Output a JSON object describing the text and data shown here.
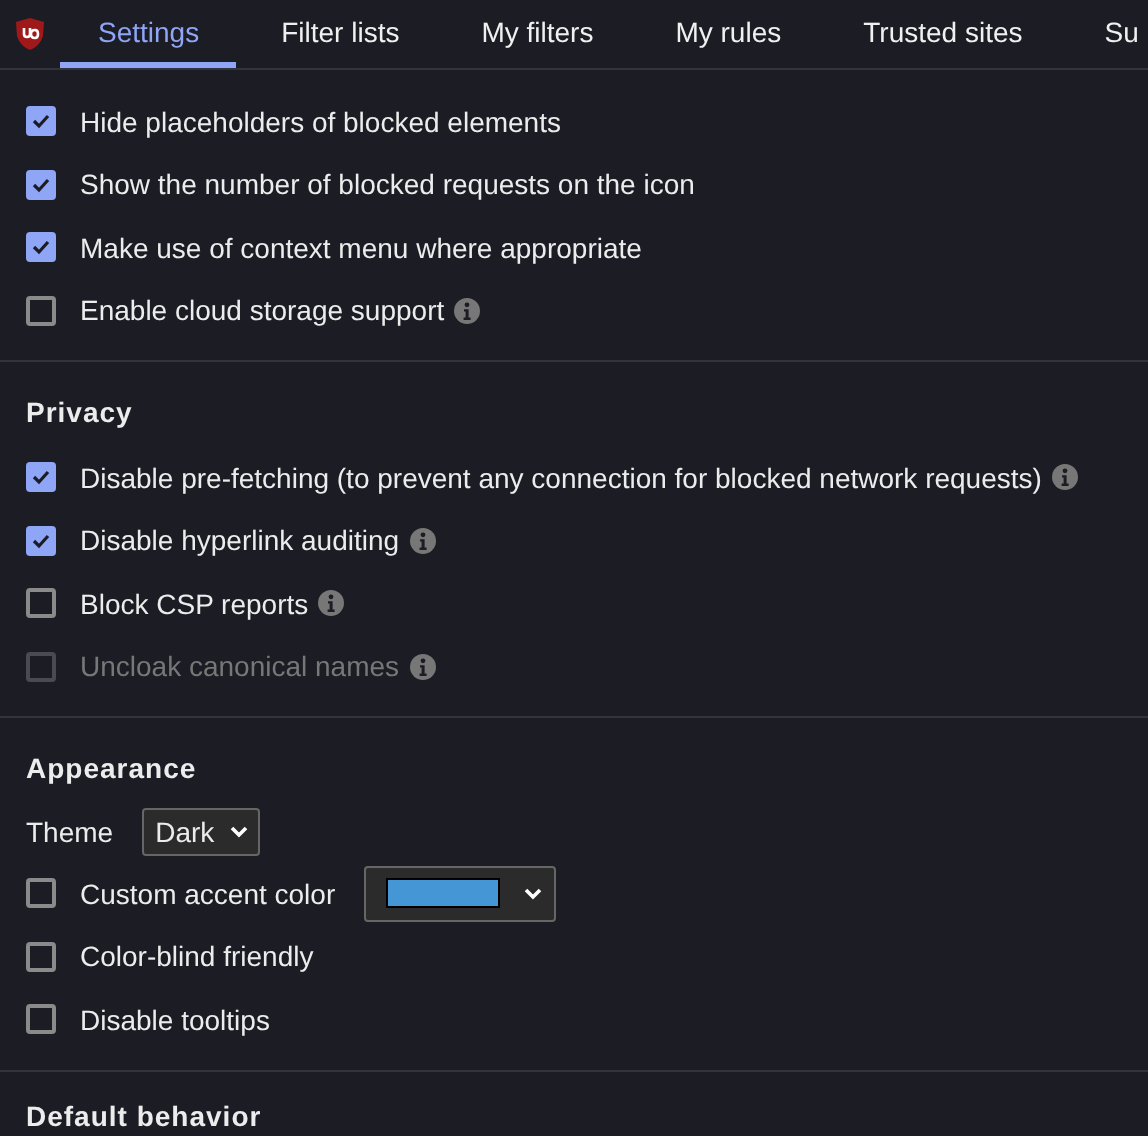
{
  "tabs": [
    {
      "label": "Settings",
      "selected": true
    },
    {
      "label": "Filter lists",
      "selected": false
    },
    {
      "label": "My filters",
      "selected": false
    },
    {
      "label": "My rules",
      "selected": false
    },
    {
      "label": "Trusted sites",
      "selected": false
    },
    {
      "label": "Su",
      "selected": false
    }
  ],
  "sections": [
    {
      "items": [
        {
          "kind": "checkbox",
          "label": "Hide placeholders of blocked elements",
          "checked": true,
          "disabled": false,
          "info": false
        },
        {
          "kind": "checkbox",
          "label": "Show the number of blocked requests on the icon",
          "checked": true,
          "disabled": false,
          "info": false
        },
        {
          "kind": "checkbox",
          "label": "Make use of context menu where appropriate",
          "checked": true,
          "disabled": false,
          "info": false
        },
        {
          "kind": "checkbox",
          "label": "Enable cloud storage support",
          "checked": false,
          "disabled": false,
          "info": true
        }
      ]
    },
    {
      "heading": "Privacy",
      "items": [
        {
          "kind": "checkbox",
          "label": "Disable pre-fetching (to prevent any connection for blocked network requests)",
          "checked": true,
          "disabled": false,
          "info": true
        },
        {
          "kind": "checkbox",
          "label": "Disable hyperlink auditing",
          "checked": true,
          "disabled": false,
          "info": true
        },
        {
          "kind": "checkbox",
          "label": "Block CSP reports",
          "checked": false,
          "disabled": false,
          "info": true
        },
        {
          "kind": "checkbox",
          "label": "Uncloak canonical names",
          "checked": false,
          "disabled": true,
          "info": true
        }
      ]
    },
    {
      "heading": "Appearance",
      "items": [
        {
          "kind": "select",
          "label": "Theme",
          "value": "Dark"
        },
        {
          "kind": "checkbox",
          "label": "Custom accent color",
          "checked": false,
          "disabled": false,
          "info": false,
          "color": "#4596d4"
        },
        {
          "kind": "checkbox",
          "label": "Color-blind friendly",
          "checked": false,
          "disabled": false,
          "info": false
        },
        {
          "kind": "checkbox",
          "label": "Disable tooltips",
          "checked": false,
          "disabled": false,
          "info": false
        }
      ]
    },
    {
      "heading": "Default behavior"
    }
  ]
}
